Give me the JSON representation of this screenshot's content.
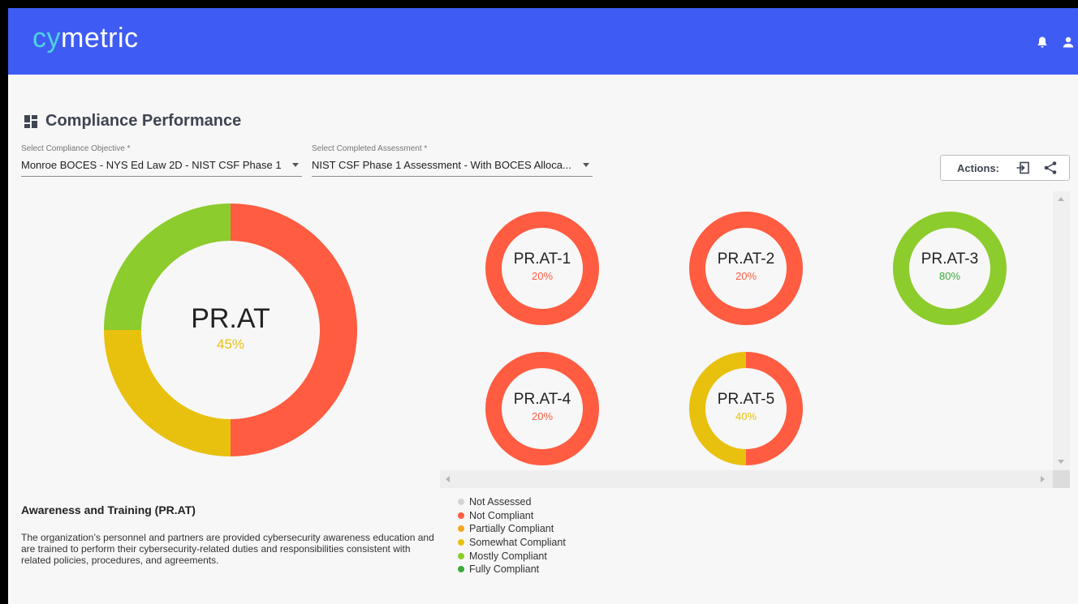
{
  "app": {
    "logo_prefix": "cy",
    "logo_suffix": "metric"
  },
  "header_icons": [
    "bell-icon",
    "user-icon"
  ],
  "page": {
    "title": "Compliance Performance"
  },
  "filters": {
    "objective": {
      "label": "Select Compliance Objective *",
      "value": "Monroe BOCES - NYS Ed Law 2D - NIST CSF Phase 1"
    },
    "assessment": {
      "label": "Select Completed Assessment *",
      "value": "NIST CSF Phase 1 Assessment - With BOCES Alloca..."
    }
  },
  "actions": {
    "label": "Actions:",
    "buttons": [
      "export-icon",
      "share-icon"
    ]
  },
  "colors": {
    "not_assessed": "#d3d3d3",
    "not_compliant": "#ff5c41",
    "partially_compliant": "#f5a623",
    "somewhat_compliant": "#e8c10e",
    "mostly_compliant": "#8ccc2c",
    "fully_compliant": "#3cab3c",
    "header": "#3e5cf3"
  },
  "main_score": {
    "code": "PR.AT",
    "percent": "45%",
    "segments": [
      {
        "status": "Not Compliant",
        "fraction": 0.5,
        "color": "#ff5c41"
      },
      {
        "status": "Somewhat Compliant",
        "fraction": 0.25,
        "color": "#e8c10e"
      },
      {
        "status": "Mostly Compliant",
        "fraction": 0.25,
        "color": "#8ccc2c"
      }
    ]
  },
  "sub_scores": [
    {
      "code": "PR.AT-1",
      "percent": "20%",
      "color": "#ff5c41",
      "segments": [
        {
          "fraction": 1.0,
          "color": "#ff5c41"
        }
      ]
    },
    {
      "code": "PR.AT-2",
      "percent": "20%",
      "color": "#ff5c41",
      "segments": [
        {
          "fraction": 1.0,
          "color": "#ff5c41"
        }
      ]
    },
    {
      "code": "PR.AT-3",
      "percent": "80%",
      "color": "#3cab3c",
      "segments": [
        {
          "fraction": 1.0,
          "color": "#8ccc2c"
        }
      ]
    },
    {
      "code": "PR.AT-4",
      "percent": "20%",
      "color": "#ff5c41",
      "segments": [
        {
          "fraction": 1.0,
          "color": "#ff5c41"
        }
      ]
    },
    {
      "code": "PR.AT-5",
      "percent": "40%",
      "color": "#e8c10e",
      "segments": [
        {
          "fraction": 0.5,
          "color": "#ff5c41"
        },
        {
          "fraction": 0.5,
          "color": "#e8c10e"
        }
      ]
    }
  ],
  "category": {
    "title": "Awareness and Training (PR.AT)",
    "description": "The organization’s personnel and partners are provided cybersecurity awareness education and are trained to perform their cybersecurity-related duties and responsibilities consistent with related policies, procedures, and agreements."
  },
  "legend": [
    {
      "label": "Not Assessed",
      "color": "#d3d3d3"
    },
    {
      "label": "Not Compliant",
      "color": "#ff5c41"
    },
    {
      "label": "Partially Compliant",
      "color": "#f5a623"
    },
    {
      "label": "Somewhat Compliant",
      "color": "#e8c10e"
    },
    {
      "label": "Mostly Compliant",
      "color": "#8ccc2c"
    },
    {
      "label": "Fully Compliant",
      "color": "#3cab3c"
    }
  ]
}
